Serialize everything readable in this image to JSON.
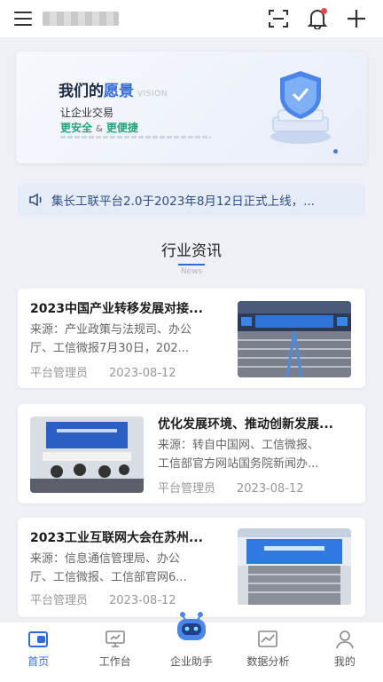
{
  "header": {
    "icons": [
      "menu-icon",
      "scan-icon",
      "bell-icon",
      "plus-icon"
    ],
    "notification_dot_color": "#e5484d"
  },
  "banner": {
    "title_prefix": "我们的",
    "title_highlight": "愿景",
    "title_en": "VISION",
    "subtitle": "让企业交易",
    "tag1": "更安全",
    "amp": "&",
    "tag2": "更便捷",
    "accent_color": "#2f6be0",
    "tag_color": "#29a37a"
  },
  "notice": {
    "icon": "speaker-icon",
    "text": "集长工联平台2.0于2023年8月12日正式上线，..."
  },
  "news_section": {
    "title": "行业资讯",
    "subtitle": "News"
  },
  "news": [
    {
      "title": "2023中国产业转移发展对接...",
      "source_line1": "来源：产业政策与法规司、办公",
      "source_line2": "厅、工信微报7月30日，202...",
      "author": "平台管理员",
      "date": "2023-08-12"
    },
    {
      "title": "优化发展环境、推动创新发展...",
      "source_line1": "来源：转自中国网、工信微报、",
      "source_line2": "工信部官方网站国务院新闻办...",
      "author": "平台管理员",
      "date": "2023-08-12"
    },
    {
      "title": "2023工业互联网大会在苏州...",
      "source_line1": "来源：信息通信管理局、办公",
      "source_line2": "厅、工信微报、工信部官网6...",
      "author": "平台管理员",
      "date": "2023-08-12"
    }
  ],
  "bottom_nav": [
    {
      "label": "首页",
      "icon": "home-wallet-icon",
      "active": true
    },
    {
      "label": "工作台",
      "icon": "monitor-icon",
      "active": false
    },
    {
      "label": "企业助手",
      "icon": "robot-icon",
      "active": false
    },
    {
      "label": "数据分析",
      "icon": "chart-icon",
      "active": false
    },
    {
      "label": "我的",
      "icon": "user-icon",
      "active": false
    }
  ]
}
